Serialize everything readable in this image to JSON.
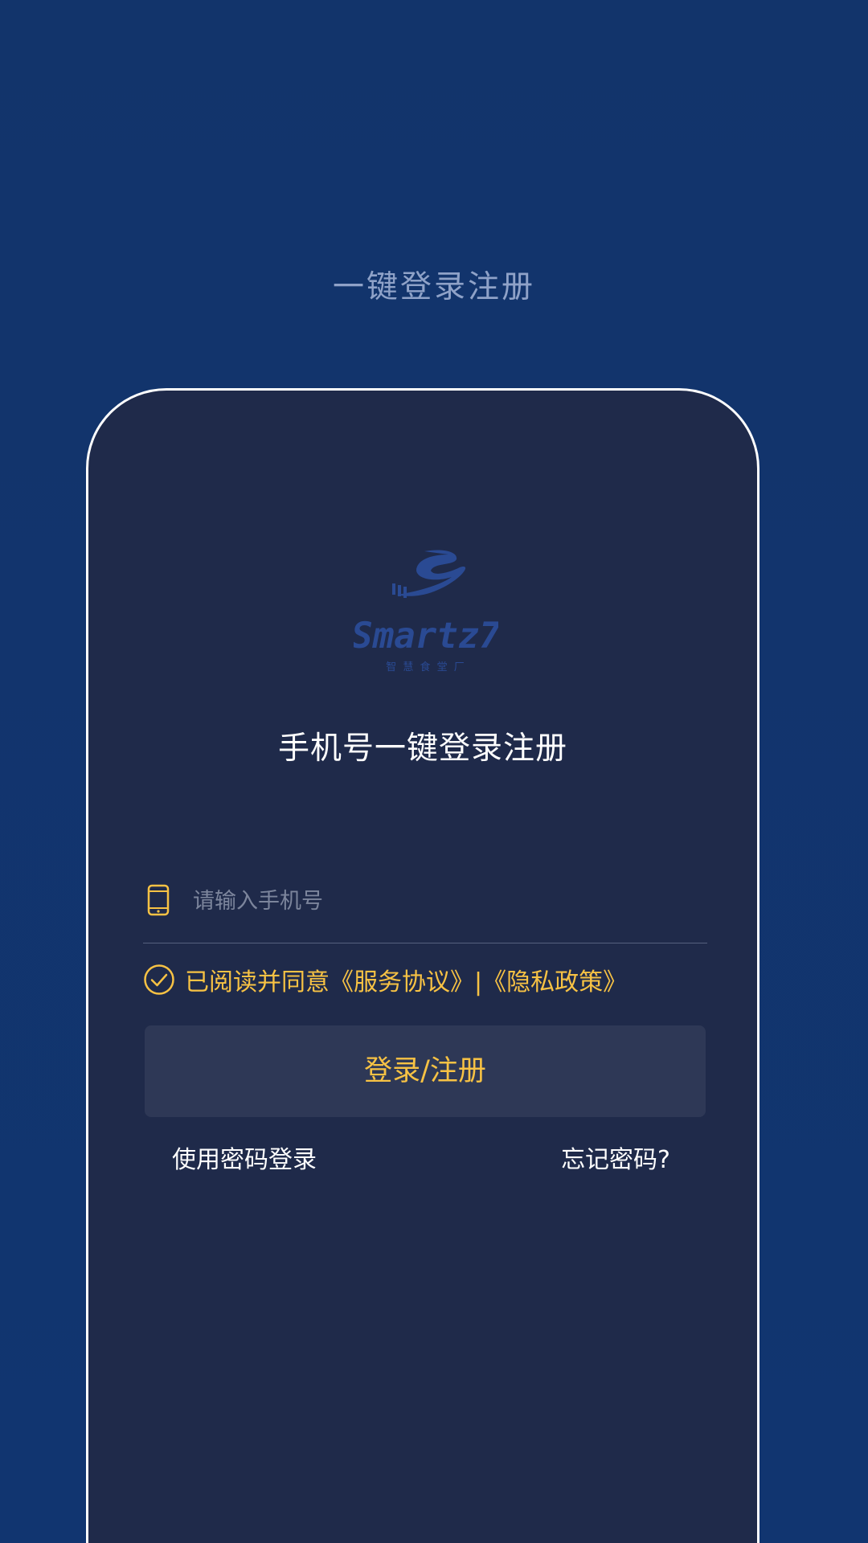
{
  "header": {
    "title": "一键登录注册"
  },
  "card": {
    "logo_text": "Smartz7",
    "logo_subtext": "智 慧 食 堂 厂",
    "title": "手机号一键登录注册",
    "phone_input": {
      "placeholder": "请输入手机号",
      "value": ""
    },
    "agreement": {
      "prefix": "已阅读并同意",
      "service_link": "《服务协议》",
      "separator": "|",
      "privacy_link": "《隐私政策》"
    },
    "login_button_label": "登录/注册",
    "password_login_label": "使用密码登录",
    "forgot_password_label": "忘记密码?"
  },
  "colors": {
    "background": "#12346b",
    "card_background": "#1f2a4a",
    "accent": "#f7c244",
    "button_background": "#2e3856",
    "header_text": "#8fa2c8"
  },
  "icons": {
    "phone": "smartphone-icon",
    "check": "check-circle-icon"
  }
}
